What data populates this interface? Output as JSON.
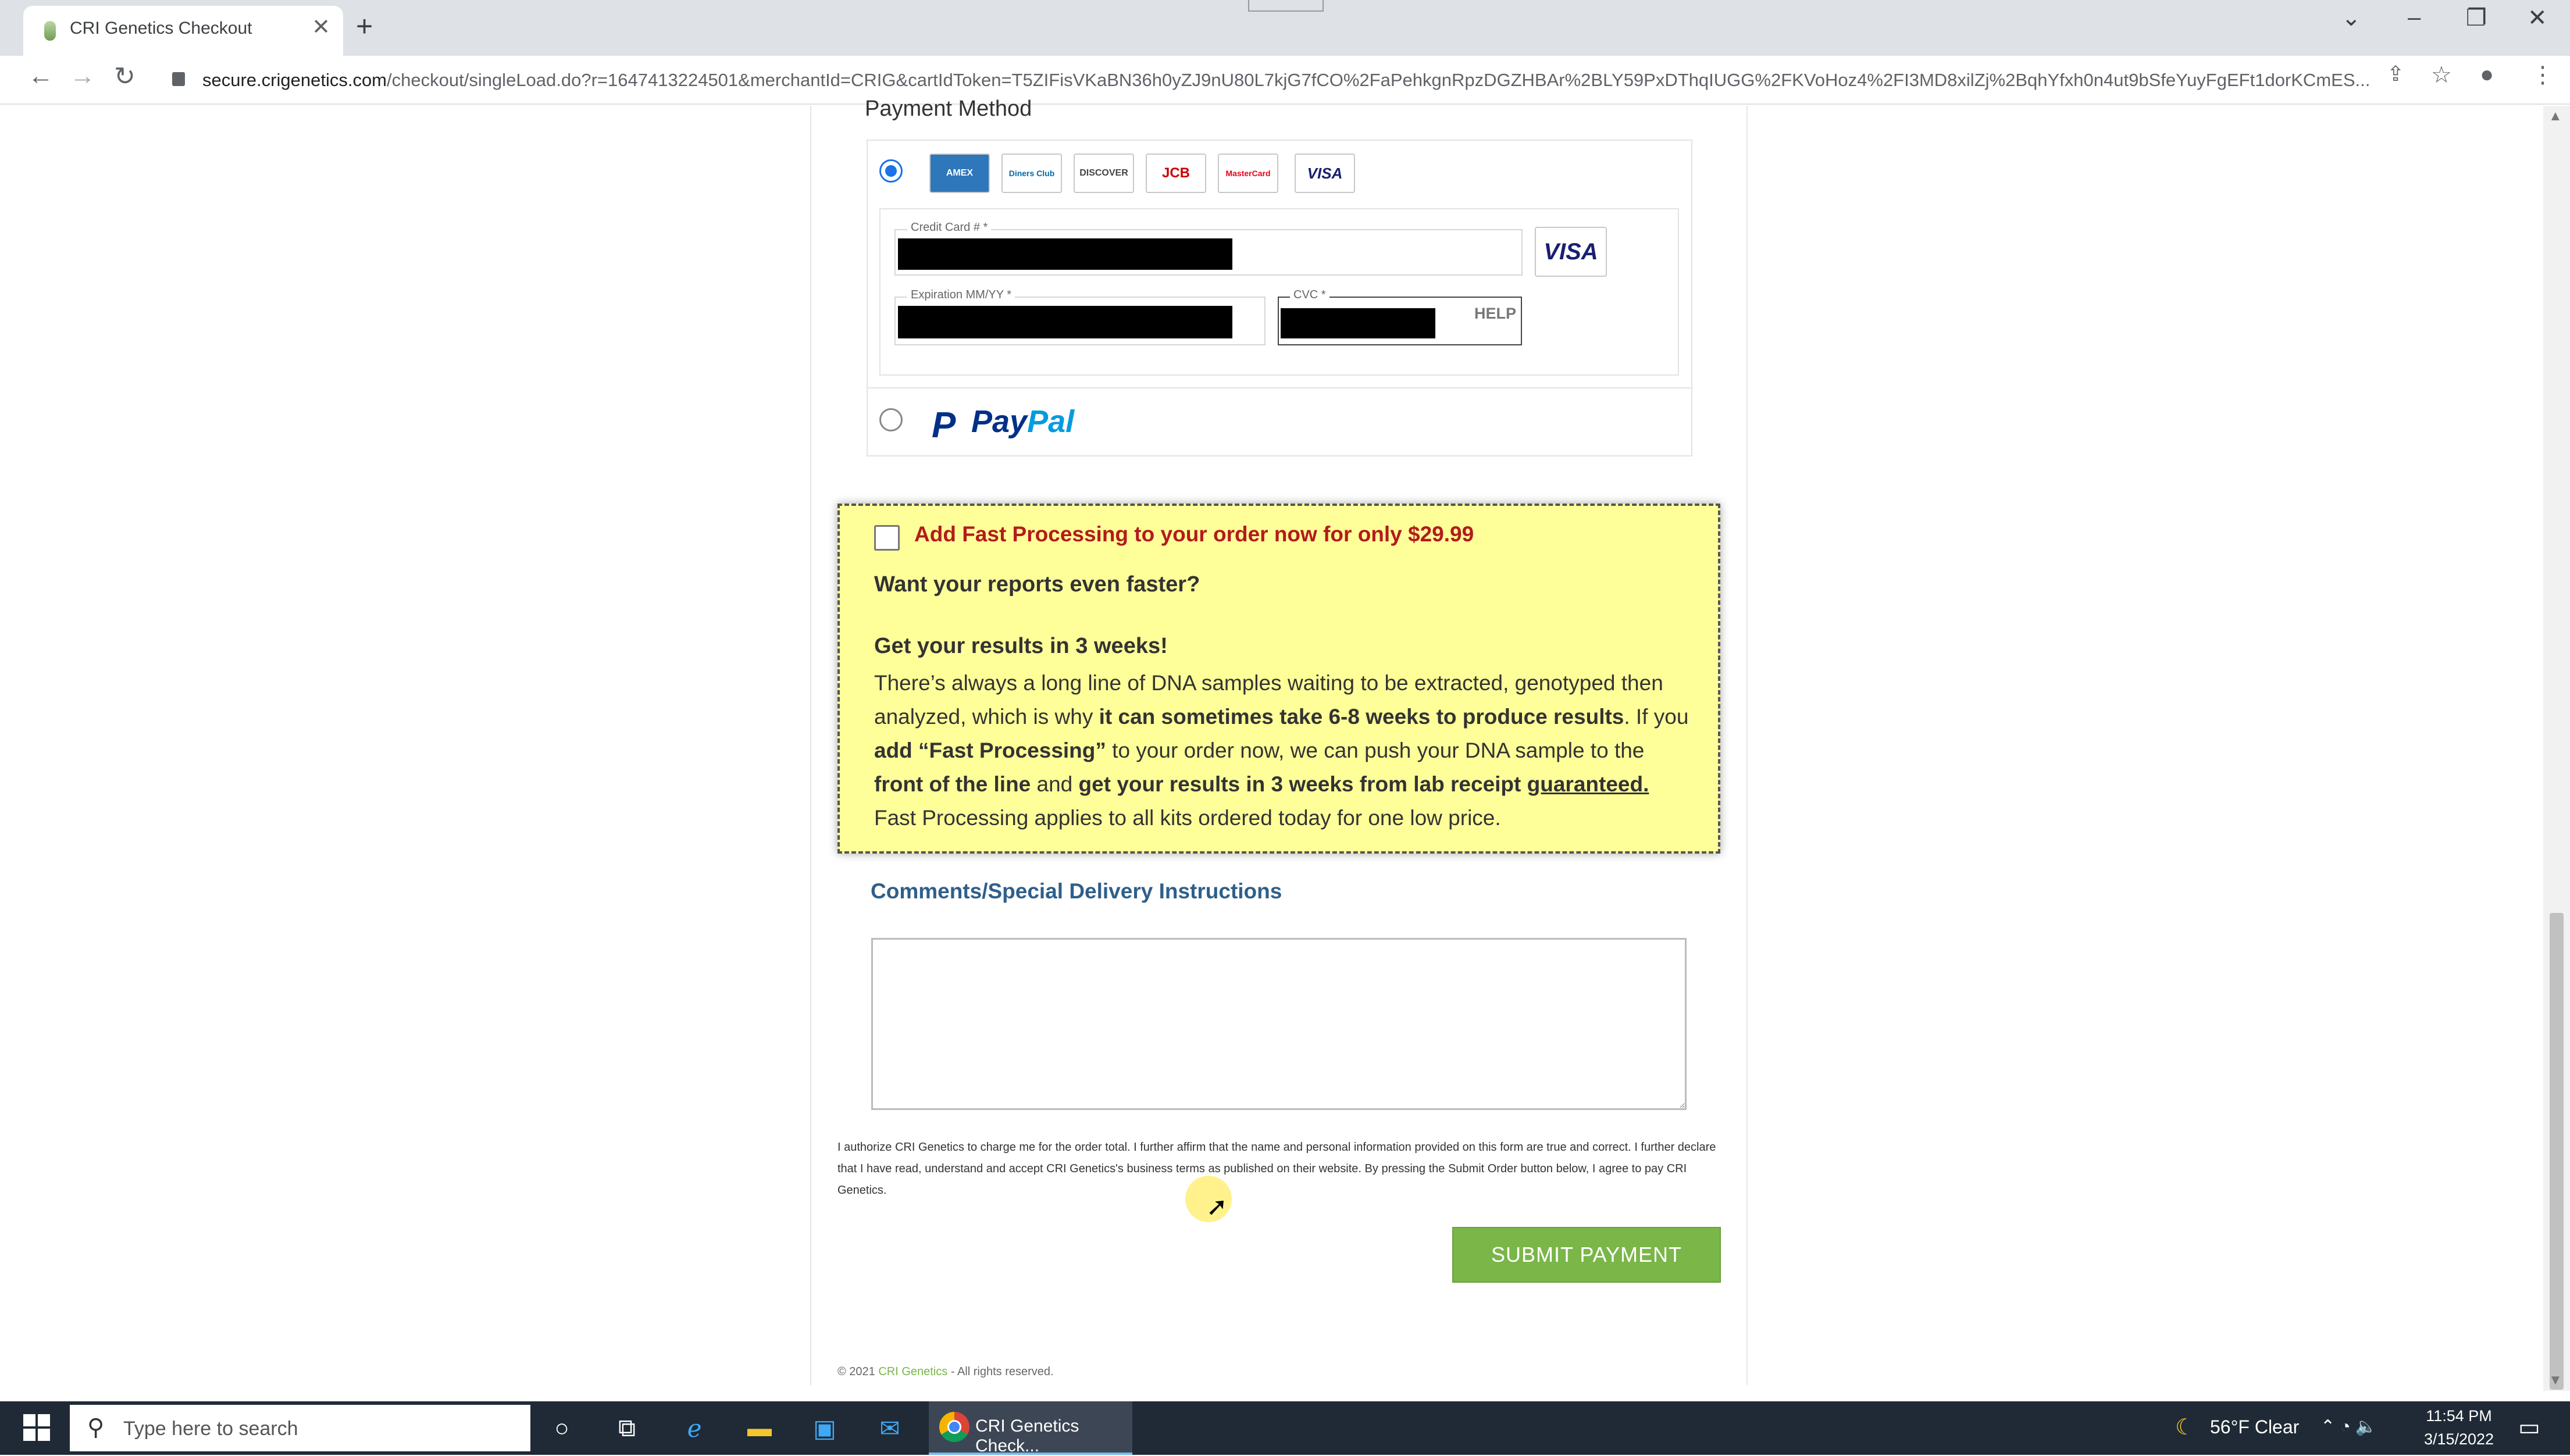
{
  "browser": {
    "tab_title": "CRI Genetics Checkout",
    "new_tab": "+",
    "tab_close": "✕",
    "url_host": "secure.crigenetics.com",
    "url_rest": "/checkout/singleLoad.do?r=1647413224501&merchantId=CRIG&cartIdToken=T5ZIFisVKaBN36h0yZJ9nU80L7kjG7fCO%2FaPehkgnRpzDGZHBAr%2BLY59PxDThqIUGG%2FKVoHoz4%2FI3MD8xilZj%2BqhYfxh0n4ut9bSfeYuyFgEFt1dorKCmES..."
  },
  "payment": {
    "title": "Payment Method",
    "cards": [
      "AMEX",
      "Diners Club",
      "DISCOVER",
      "JCB",
      "MasterCard",
      "VISA"
    ],
    "credit_card_label": "Credit Card # *",
    "expiration_label": "Expiration MM/YY *",
    "cvc_label": "CVC *",
    "help": "HELP",
    "detected_brand": "VISA",
    "paypal_pay": "Pay",
    "paypal_pal": "Pal"
  },
  "promo": {
    "offer": "Add Fast Processing to your order now for only $29.99",
    "question": "Want your reports even faster?",
    "headline": "Get your results in 3 weeks!",
    "body_1": "There’s always a long line of DNA samples waiting to be extracted, genotyped then analyzed, which is why ",
    "body_2": "it can sometimes take 6-8 weeks to produce results",
    "body_3": ". If you ",
    "body_4": "add “Fast Processing”",
    "body_5": " to your order now, we can push your DNA sample to the ",
    "body_6": "front of the line",
    "body_7": " and ",
    "body_8": "get your results in 3 weeks from lab receipt",
    "body_9": "guaranteed.",
    "body_10": " Fast Processing applies to all kits ordered today for one low price."
  },
  "comments": {
    "title": "Comments/Special Delivery Instructions",
    "value": ""
  },
  "legal": "I authorize CRI Genetics to charge me for the order total. I further affirm that the name and personal information provided on this form are true and correct. I further declare that I have read, understand and accept CRI Genetics's business terms as published on their website. By pressing the Submit Order button below, I agree to pay CRI Genetics.",
  "submit_label": "SUBMIT PAYMENT",
  "footer": {
    "prefix": "© 2021 ",
    "brand": "CRI Genetics",
    "suffix": " - All rights reserved."
  },
  "taskbar": {
    "search_placeholder": "Type here to search",
    "chrome_task_label": "CRI Genetics Check...",
    "weather": "56°F  Clear",
    "time": "11:54 PM",
    "date": "3/15/2022"
  }
}
